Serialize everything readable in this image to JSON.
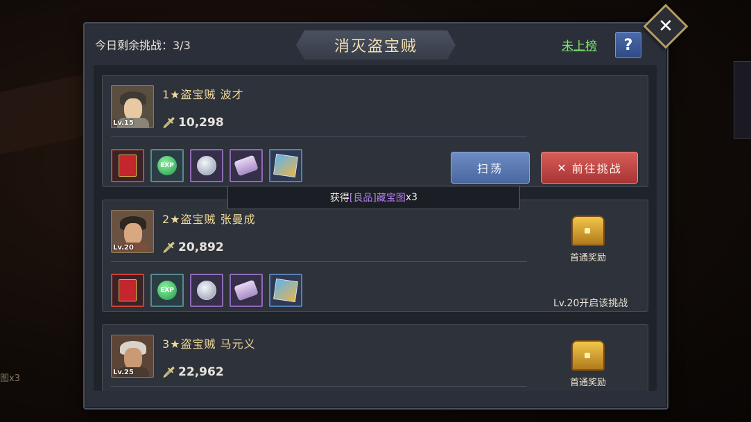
{
  "header": {
    "challenges_label": "今日剩余挑战：3/3",
    "title": "消灭盗宝贼",
    "rank_link": "未上榜",
    "help": "?",
    "close": "✕"
  },
  "tooltip": {
    "prefix": "获得 ",
    "highlight": "[良品]藏宝图",
    "suffix": "x3"
  },
  "cards": [
    {
      "level": "Lv.15",
      "name": "1★盗宝贼 波才",
      "power": "10,298",
      "sweep": "扫荡",
      "challenge": "前往挑战",
      "items": [
        "book-icon",
        "exp-icon",
        "silver-coin-icon",
        "scroll-icon",
        "treasure-map-icon"
      ]
    },
    {
      "level": "Lv.20",
      "name": "2★盗宝贼 张曼成",
      "power": "20,892",
      "chest_label": "首通奖励",
      "unlock": "Lv.20开启该挑战",
      "items": [
        "book-icon",
        "exp-icon",
        "silver-coin-icon",
        "scroll-icon",
        "treasure-map-icon"
      ]
    },
    {
      "level": "Lv.25",
      "name": "3★盗宝贼 马元义",
      "power": "22,962",
      "chest_label": "首通奖励"
    }
  ],
  "exp_text": "EXP",
  "background": {
    "side_text": "图x3"
  },
  "colors": {
    "panel": "#2b2f39",
    "title_text": "#f0dfb0",
    "rank_link": "#7ee36b",
    "challenge_button": "#c44a47",
    "sweep_button": "#5b79b2",
    "rarity_purple": "#b27ef0"
  }
}
